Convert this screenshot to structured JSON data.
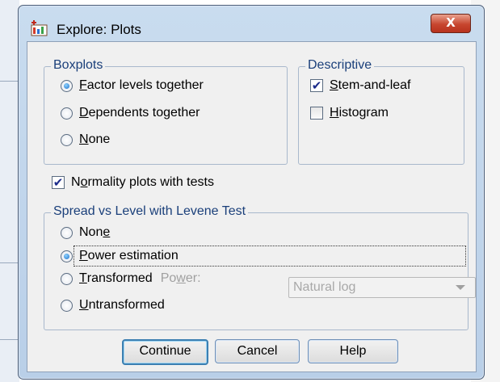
{
  "window": {
    "title": "Explore: Plots",
    "close_symbol": "X"
  },
  "boxplots": {
    "legend": "Boxplots",
    "options": [
      {
        "prefix": "",
        "key": "F",
        "rest": "actor levels together",
        "selected": true
      },
      {
        "prefix": "",
        "key": "D",
        "rest": "ependents together",
        "selected": false
      },
      {
        "prefix": "",
        "key": "N",
        "rest": "one",
        "selected": false
      }
    ]
  },
  "descriptive": {
    "legend": "Descriptive",
    "stem_leaf": {
      "key": "S",
      "rest": "tem-and-leaf",
      "checked": true
    },
    "histogram": {
      "key": "H",
      "rest": "istogram",
      "checked": false
    }
  },
  "normality": {
    "prefix": "N",
    "key": "o",
    "rest": "rmality plots with tests",
    "checked": true
  },
  "spread": {
    "legend": "Spread vs Level with Levene Test",
    "options": [
      {
        "prefix": "Non",
        "key": "e",
        "rest": "",
        "selected": false
      },
      {
        "prefix": "",
        "key": "P",
        "rest": "ower estimation",
        "selected": true
      },
      {
        "prefix": "",
        "key": "T",
        "rest": "ransformed",
        "selected": false
      },
      {
        "prefix": "",
        "key": "U",
        "rest": "ntransformed",
        "selected": false
      }
    ],
    "power_label_prefix": "Po",
    "power_label_key": "w",
    "power_label_rest": "er:",
    "power_value": "Natural log"
  },
  "buttons": {
    "continue": "Continue",
    "cancel": "Cancel",
    "help": "Help"
  },
  "check_symbol": "✔"
}
